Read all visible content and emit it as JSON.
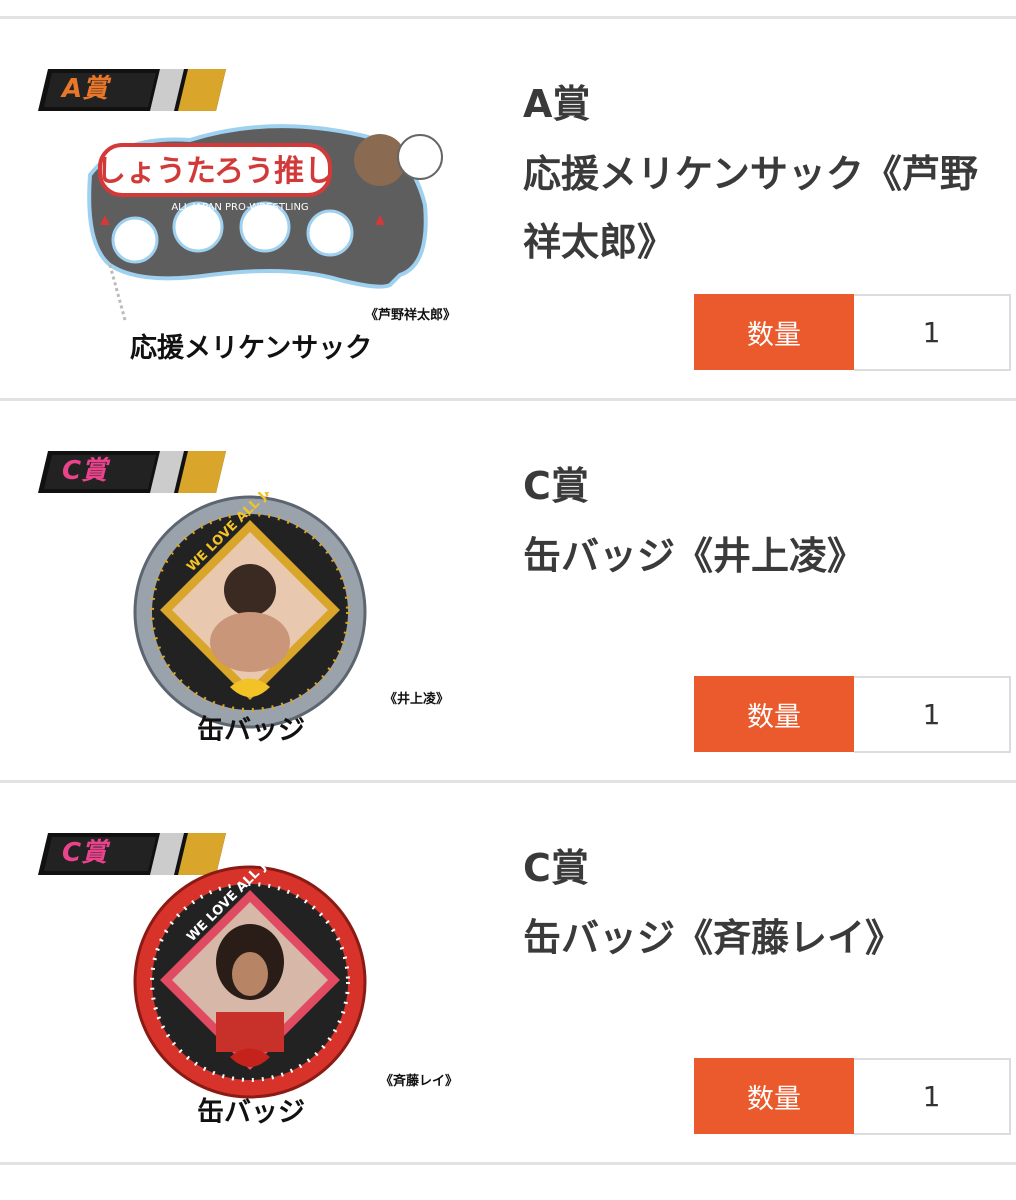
{
  "items": [
    {
      "rank_tag": "A賞",
      "rank_tag_color": "#e8772a",
      "rank": "A賞",
      "name": "応援メリケンサック《芦野祥太郎》",
      "art_caption": "応援メリケンサック",
      "art_subcaption": "《芦野祥太郎》",
      "art_logo_text": "しょうたろう推し",
      "art_small_text": "ALL JAPAN PRO-WRESTLING",
      "qty_label": "数量",
      "qty_value": "1"
    },
    {
      "rank_tag": "C賞",
      "rank_tag_color": "#e9438b",
      "rank": "C賞",
      "name": "缶バッジ《井上凌》",
      "art_caption": "缶バッジ",
      "art_subcaption": "《井上凌》",
      "art_ring_text": "WE LOVE ALL JAPAN",
      "badge_color": "#9aa3ab",
      "qty_label": "数量",
      "qty_value": "1"
    },
    {
      "rank_tag": "C賞",
      "rank_tag_color": "#e9438b",
      "rank": "C賞",
      "name": "缶バッジ《斉藤レイ》",
      "art_caption": "缶バッジ",
      "art_subcaption": "《斉藤レイ》",
      "art_ring_text": "WE LOVE ALL JAPAN",
      "badge_color": "#d8332b",
      "qty_label": "数量",
      "qty_value": "1"
    }
  ],
  "colors": {
    "accent": "#ea5a2c",
    "divider": "#e2e2e2"
  }
}
